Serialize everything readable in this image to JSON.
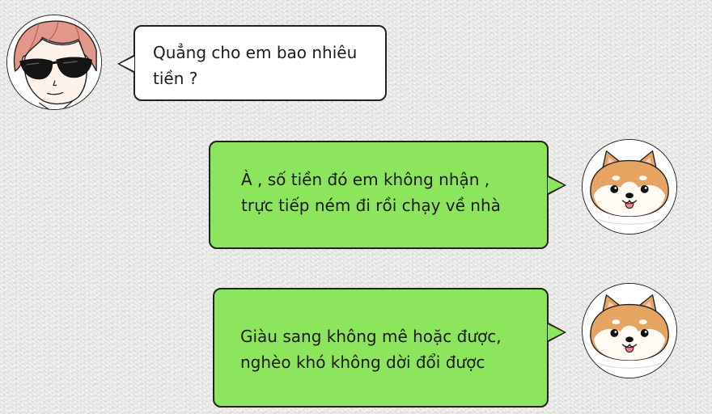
{
  "messages": [
    {
      "sender": "guy-with-sunglasses",
      "side": "left",
      "bubble_color": "#ffffff",
      "lines": [
        "Quẳng cho em bao nhiêu",
        "tiền ?"
      ]
    },
    {
      "sender": "shiba-dog",
      "side": "right",
      "bubble_color": "#8de55d",
      "lines": [
        "À , số tiền đó em không nhận ,",
        " trực tiếp ném đi rồi chạy về nhà"
      ]
    },
    {
      "sender": "shiba-dog",
      "side": "right",
      "bubble_color": "#8de55d",
      "lines": [
        "Giàu sang không mê hoặc được,",
        "nghèo khó không dời đổi được"
      ]
    }
  ],
  "colors": {
    "background": "#e9e9e7",
    "incoming_bubble": "#ffffff",
    "outgoing_bubble": "#8de55d",
    "outline": "#222222",
    "guy_hair": "#e3968a",
    "dog_fur": "#e6a463"
  },
  "icons": {
    "left_avatar": "guy-sunglasses-avatar-icon",
    "right_avatar": "shiba-dog-avatar-icon"
  }
}
